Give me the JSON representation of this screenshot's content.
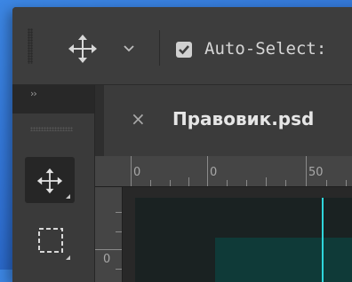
{
  "options_bar": {
    "auto_select_label": "Auto-Select:",
    "auto_select_checked": true
  },
  "tools_panel": {
    "collapse_glyph": "››",
    "tools": [
      {
        "name": "move-tool",
        "icon": "move-arrows-icon",
        "selected": true
      },
      {
        "name": "rectangular-marquee-tool",
        "icon": "dashed-rectangle-icon",
        "selected": false
      }
    ]
  },
  "document": {
    "tab_close_glyph": "×",
    "tab_title": "Правовик.psd",
    "ruler_labels": [
      "0",
      "0",
      "50"
    ],
    "vertical_ruler_label": "0"
  },
  "colors": {
    "background": "#2f6fd0",
    "panel": "#3b3b3b",
    "canvas": "#0f3a38",
    "guide": "#2fd6dc"
  }
}
